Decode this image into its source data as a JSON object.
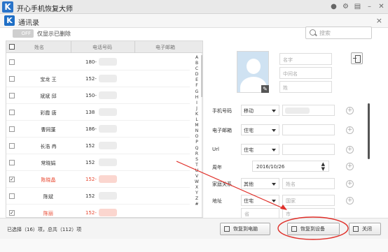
{
  "app": {
    "title": "开心手机恢复大师",
    "logo_letter": "K"
  },
  "window_icons": [
    "chat-icon",
    "settings-icon",
    "menu-icon",
    "minimize-icon",
    "close-icon"
  ],
  "module": {
    "logo_letter": "K",
    "title": "通讯录",
    "close": "×"
  },
  "toolbar": {
    "toggle_text": "OFF",
    "toggle_label": "仅显示已删除"
  },
  "search": {
    "placeholder": "搜索"
  },
  "list": {
    "columns": [
      "姓名",
      "电话号码",
      "电子邮箱"
    ],
    "rows": [
      {
        "name": "",
        "phone": "180-",
        "checked": false,
        "selected": false
      },
      {
        "name": "宝龙 王",
        "phone": "152-",
        "checked": false,
        "selected": false
      },
      {
        "name": "斌斌 邱",
        "phone": "150-",
        "checked": false,
        "selected": false
      },
      {
        "name": "彩霞 唐",
        "phone": "138",
        "checked": false,
        "selected": false
      },
      {
        "name": "曹同蓬",
        "phone": "186-",
        "checked": false,
        "selected": false
      },
      {
        "name": "长浩 冉",
        "phone": "152",
        "checked": false,
        "selected": false
      },
      {
        "name": "常晓娟",
        "phone": "152",
        "checked": false,
        "selected": false
      },
      {
        "name": "陈晓晶",
        "phone": "152-",
        "checked": true,
        "selected": true
      },
      {
        "name": "陈斌",
        "phone": "152",
        "checked": false,
        "selected": false
      },
      {
        "name": "陈丽",
        "phone": "152-",
        "checked": true,
        "selected": true
      }
    ],
    "alphabet": [
      "A",
      "B",
      "C",
      "D",
      "E",
      "F",
      "G",
      "H",
      "I",
      "J",
      "K",
      "L",
      "M",
      "N",
      "O",
      "P",
      "Q",
      "R",
      "S",
      "T",
      "U",
      "V",
      "W",
      "X",
      "Y",
      "Z",
      "#"
    ]
  },
  "detail": {
    "name_fields": [
      "名字",
      "中间名",
      "姓"
    ],
    "fields": {
      "phone": {
        "label": "手机号码",
        "type": "移动"
      },
      "email": {
        "label": "电子邮箱",
        "type": "住宅"
      },
      "url": {
        "label": "Url",
        "type": "住宅"
      },
      "anniversary": {
        "label": "周年",
        "date": "2016/10/26"
      },
      "family": {
        "label": "家庭关系",
        "type": "其他",
        "placeholder": "姓名"
      },
      "address": {
        "label": "地址",
        "type": "住宅",
        "country_placeholder": "国家",
        "extra1": "省",
        "extra2": "市"
      }
    }
  },
  "bottom": {
    "status": "已选择（16）项，总共（112）项",
    "buttons": {
      "to_computer": "恢复到电脑",
      "to_device": "恢复到设备",
      "close": "关闭"
    }
  },
  "annotation_color": "#e0302a"
}
